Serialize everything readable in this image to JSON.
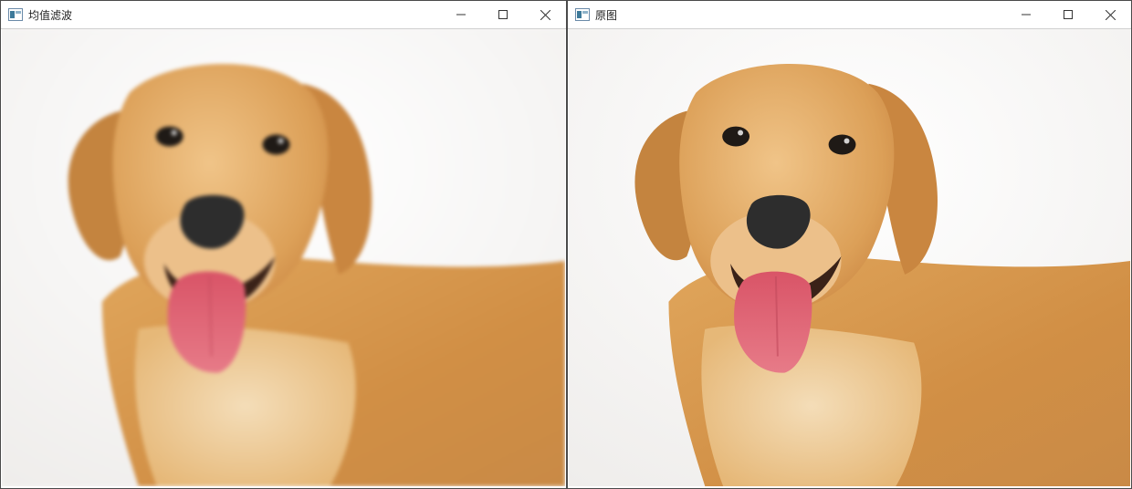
{
  "windows": [
    {
      "title": "均值滤波",
      "image": {
        "subject": "golden-retriever-photo",
        "filter": "mean-blur"
      },
      "controls": {
        "minimize_icon": "minimize-icon",
        "maximize_icon": "maximize-icon",
        "close_icon": "close-icon"
      }
    },
    {
      "title": "原图",
      "image": {
        "subject": "golden-retriever-photo",
        "filter": "none"
      },
      "controls": {
        "minimize_icon": "minimize-icon",
        "maximize_icon": "maximize-icon",
        "close_icon": "close-icon"
      }
    }
  ],
  "colors": {
    "titlebar": "#ffffff",
    "background": "#f6f5f3",
    "fur": "#d99a4e",
    "tongue": "#e06a78"
  }
}
